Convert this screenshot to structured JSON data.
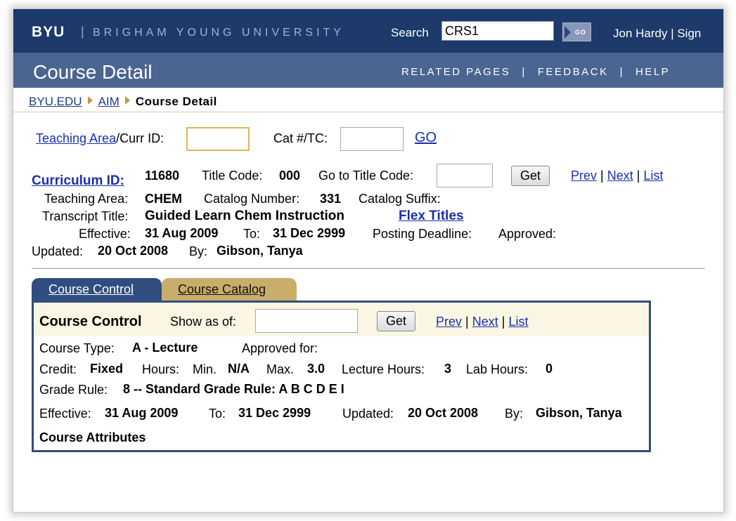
{
  "header": {
    "logo": "BYU",
    "separator": "|",
    "university": "BRIGHAM YOUNG UNIVERSITY",
    "search_label": "Search",
    "search_value": "CRS1",
    "go_label": "GO",
    "user": "Jon Hardy | Sign"
  },
  "titlebar": {
    "title": "Course Detail",
    "nav": [
      "RELATED PAGES",
      "FEEDBACK",
      "HELP"
    ],
    "pipe": "|"
  },
  "breadcrumb": {
    "items": [
      "BYU.EDU",
      "AIM"
    ],
    "current": "Course Detail"
  },
  "search_form": {
    "teaching_area_link": "Teaching Area",
    "curr_id_label": "/Curr ID:",
    "cat_label": "Cat #/TC:",
    "go_link": "GO"
  },
  "curriculum": {
    "curr_id_label": "Curriculum ID:",
    "curr_id": "11680",
    "title_code_label": "Title Code:",
    "title_code": "000",
    "goto_label": "Go to Title Code:",
    "get_label": "Get",
    "prev": "Prev",
    "next": "Next",
    "list": "List",
    "sep": "|",
    "teaching_area_label": "Teaching Area:",
    "teaching_area": "CHEM",
    "catalog_number_label": "Catalog Number:",
    "catalog_number": "331",
    "catalog_suffix_label": "Catalog Suffix:",
    "transcript_title_label": "Transcript Title:",
    "transcript_title": "Guided Learn Chem Instruction",
    "flex_titles": "Flex Titles",
    "effective_label": "Effective:",
    "effective": "31 Aug 2009",
    "to_label": "To:",
    "to": "31 Dec 2999",
    "posting_deadline_label": "Posting Deadline:",
    "approved_label": "Approved:",
    "updated_label": "Updated:",
    "updated": "20 Oct 2008",
    "by_label": "By:",
    "by": "Gibson, Tanya"
  },
  "tabs": [
    "Course Control",
    "Course Catalog"
  ],
  "control": {
    "heading": "Course Control",
    "show_as_of_label": "Show as of:",
    "get_label": "Get",
    "prev": "Prev",
    "next": "Next",
    "list": "List",
    "sep": "|",
    "course_type_label": "Course Type:",
    "course_type": "A - Lecture",
    "approved_for_label": "Approved for:",
    "credit_label": "Credit:",
    "credit": "Fixed",
    "hours_label": "Hours:",
    "min_label": "Min.",
    "min": "N/A",
    "max_label": "Max.",
    "max": "3.0",
    "lecture_hours_label": "Lecture Hours:",
    "lecture_hours": "3",
    "lab_hours_label": "Lab Hours:",
    "lab_hours": "0",
    "grade_rule_label": "Grade Rule:",
    "grade_rule": "8 -- Standard Grade Rule: A B C D E I",
    "effective_label": "Effective:",
    "effective": "31 Aug 2009",
    "to_label": "To:",
    "to": "31 Dec 2999",
    "updated_label": "Updated:",
    "updated": "20 Oct 2008",
    "by_label": "By:",
    "by": "Gibson, Tanya",
    "attributes_heading": "Course Attributes"
  }
}
